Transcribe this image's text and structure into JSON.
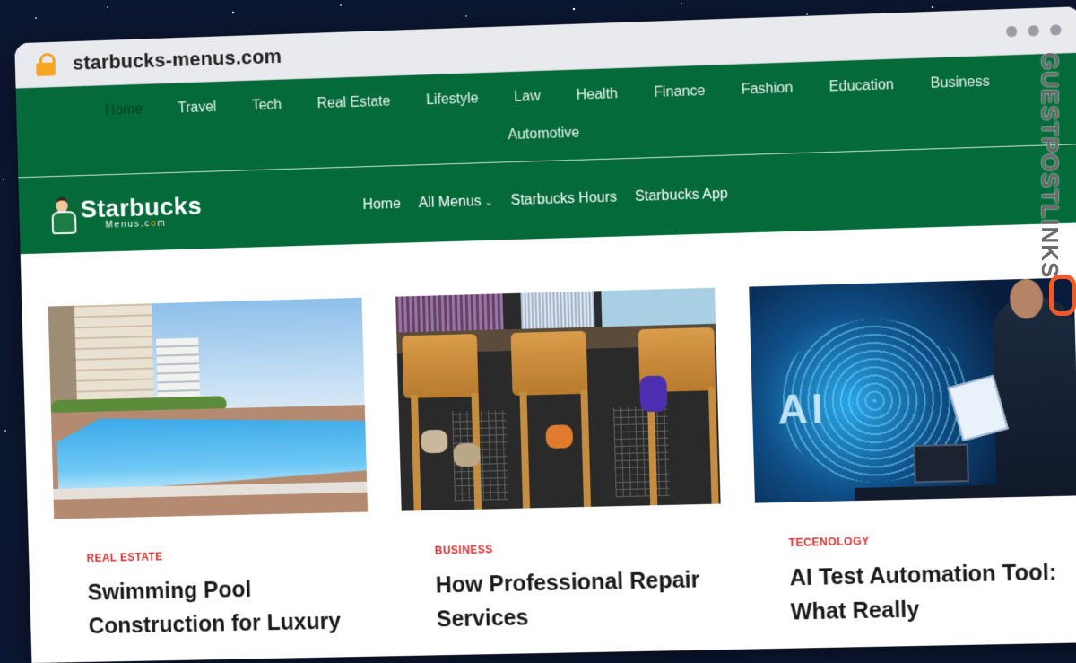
{
  "browser": {
    "url": "starbucks-menus.com"
  },
  "top_nav": {
    "items": [
      {
        "label": "Home"
      },
      {
        "label": "Travel"
      },
      {
        "label": "Tech"
      },
      {
        "label": "Real Estate"
      },
      {
        "label": "Lifestyle"
      },
      {
        "label": "Law"
      },
      {
        "label": "Health"
      },
      {
        "label": "Finance"
      },
      {
        "label": "Fashion"
      },
      {
        "label": "Education"
      },
      {
        "label": "Business"
      },
      {
        "label": "Automotive"
      }
    ]
  },
  "header": {
    "logo_main": "Starbucks",
    "logo_sub_1": "Menus.c",
    "logo_sub_o": "o",
    "logo_sub_2": "m",
    "menu": {
      "home": "Home",
      "all_menus": "All Menus",
      "hours": "Starbucks Hours",
      "app": "Starbucks App"
    }
  },
  "posts": [
    {
      "category": "REAL ESTATE",
      "title": "Swimming Pool Construction for Luxury"
    },
    {
      "category": "BUSINESS",
      "title": "How Professional Repair Services"
    },
    {
      "category": "TECENOLOGY",
      "title": "AI Test Automation Tool: What Really"
    }
  ],
  "images": {
    "ai_text": "AI"
  },
  "watermark": {
    "text": "GUESTPOSTLINKS"
  },
  "colors": {
    "nav_green": "#056a3a",
    "category_red": "#d32f2f",
    "lock_orange": "#f5a623",
    "watermark_orange": "#f1592a"
  }
}
